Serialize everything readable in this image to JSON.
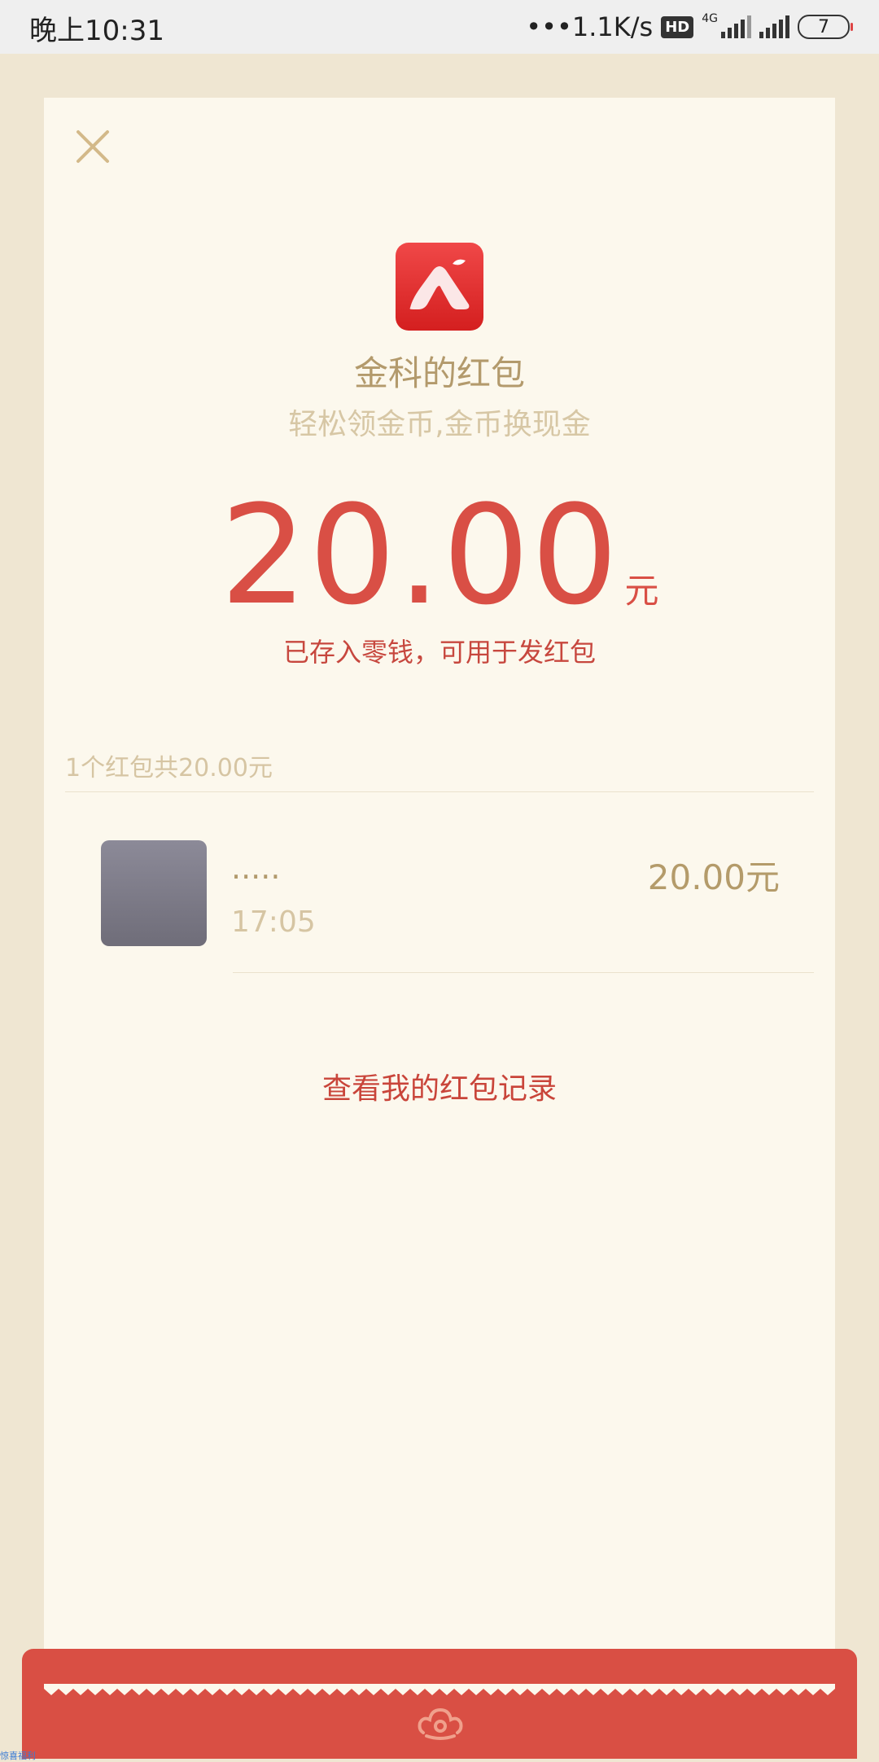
{
  "status_bar": {
    "time": "晚上10:31",
    "network_speed": "•••1.1K/s",
    "hd_badge": "HD",
    "network_type": "4G",
    "battery_level": "7"
  },
  "redpacket": {
    "sender_title": "金科的红包",
    "subtitle": "轻松领金币,金币换现金",
    "amount": "20.00",
    "unit": "元",
    "saved_note": "已存入零钱，可用于发红包",
    "summary": "1个红包共20.00元",
    "entries": [
      {
        "name": ".....",
        "time": "17:05",
        "amount": "20.00元"
      }
    ],
    "records_link": "查看我的红包记录"
  },
  "colors": {
    "accent_red": "#d94f45",
    "gold_text": "#b39a6c",
    "card_bg": "#fcf8ed",
    "page_bg": "#efe6d2"
  },
  "icons": {
    "close": "close-icon",
    "logo": "app-logo-icon",
    "envelope_emblem": "cloud-emblem-icon"
  },
  "corner_text": "惊喜福利"
}
